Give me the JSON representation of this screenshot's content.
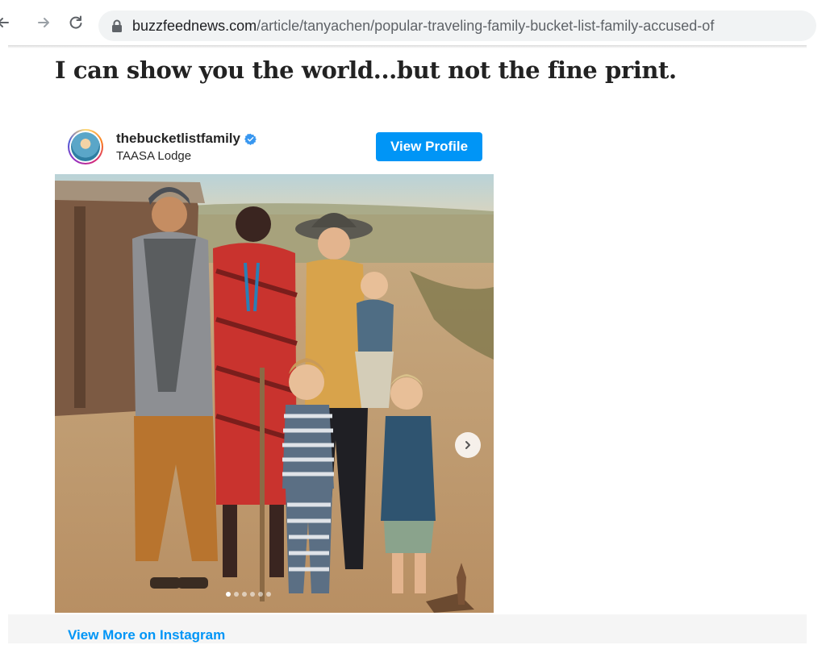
{
  "browser": {
    "url_domain": "buzzfeednews.com",
    "url_path": "/article/tanyachen/popular-traveling-family-bucket-list-family-accused-of"
  },
  "article": {
    "headline": "I can show you the world...but not the fine print."
  },
  "instagram_embed": {
    "username": "thebucketlistfamily",
    "location": "TAASA Lodge",
    "view_profile_label": "View Profile",
    "view_more_label": "View More on Instagram",
    "carousel": {
      "total_slides": 6,
      "active_index": 0
    },
    "colors": {
      "accent": "#0095f6",
      "verified": "#3897f0"
    },
    "icons": [
      "back-arrow-icon",
      "forward-arrow-icon",
      "reload-icon",
      "lock-icon",
      "verified-badge-icon",
      "chevron-right-icon"
    ]
  }
}
